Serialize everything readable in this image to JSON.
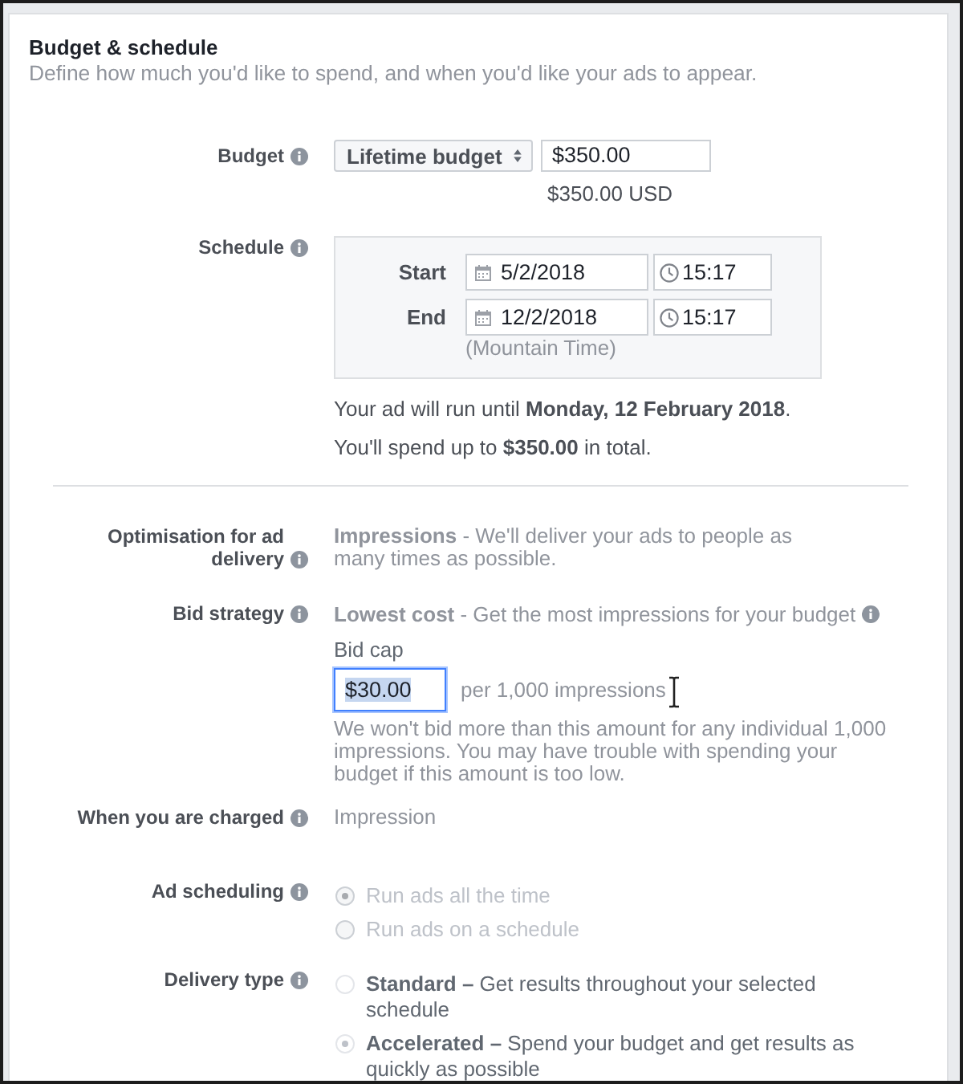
{
  "section": {
    "title": "Budget & schedule",
    "subtitle": "Define how much you'd like to spend, and when you'd like your ads to appear."
  },
  "budget_rows": [
    {
      "kind": "budget",
      "label": "Budget",
      "budget_type": "Lifetime budget",
      "amount": "$350.00",
      "amount_note": "$350.00 USD"
    },
    {
      "kind": "schedule",
      "label": "Schedule",
      "times": [
        {
          "label": "Start",
          "date": "5/2/2018",
          "time": "15:17"
        },
        {
          "label": "End",
          "date": "12/2/2018",
          "time": "15:17"
        }
      ],
      "timezone": "(Mountain Time)",
      "summary": [
        "Your ad will run until **Monday, 12 February 2018**.",
        "You'll spend up to **$350.00** in total."
      ]
    }
  ],
  "delivery_rows": [
    {
      "kind": "text",
      "label": "Optimisation for ad delivery",
      "value": "**Impressions** - We'll deliver your ads to people as many times as possible."
    },
    {
      "kind": "bid",
      "label": "Bid strategy",
      "value": "**Lowest cost** - Get the most impressions for your budget",
      "bid_cap": {
        "label": "Bid cap",
        "value": "$30.00",
        "focused": true,
        "unit": "per 1,000 impressions",
        "help": "We won't bid more than this amount for any individual 1,000 impressions. You may have trouble with spending your budget if this amount is too low."
      }
    },
    {
      "kind": "text",
      "label": "When you are charged",
      "value": "Impression"
    },
    {
      "kind": "radios",
      "label": "Ad scheduling",
      "options": [
        {
          "label": "Run ads all the time",
          "selected": true,
          "disabled": true
        },
        {
          "label": "Run ads on a schedule",
          "selected": false,
          "disabled": true
        }
      ]
    },
    {
      "kind": "radios",
      "label": "Delivery type",
      "options": [
        {
          "label": "**Standard –** Get results throughout your selected schedule",
          "selected": false,
          "disabled": false
        },
        {
          "label": "**Accelerated –** Spend your budget and get results as quickly as possible",
          "selected": true,
          "disabled": false
        }
      ]
    }
  ]
}
